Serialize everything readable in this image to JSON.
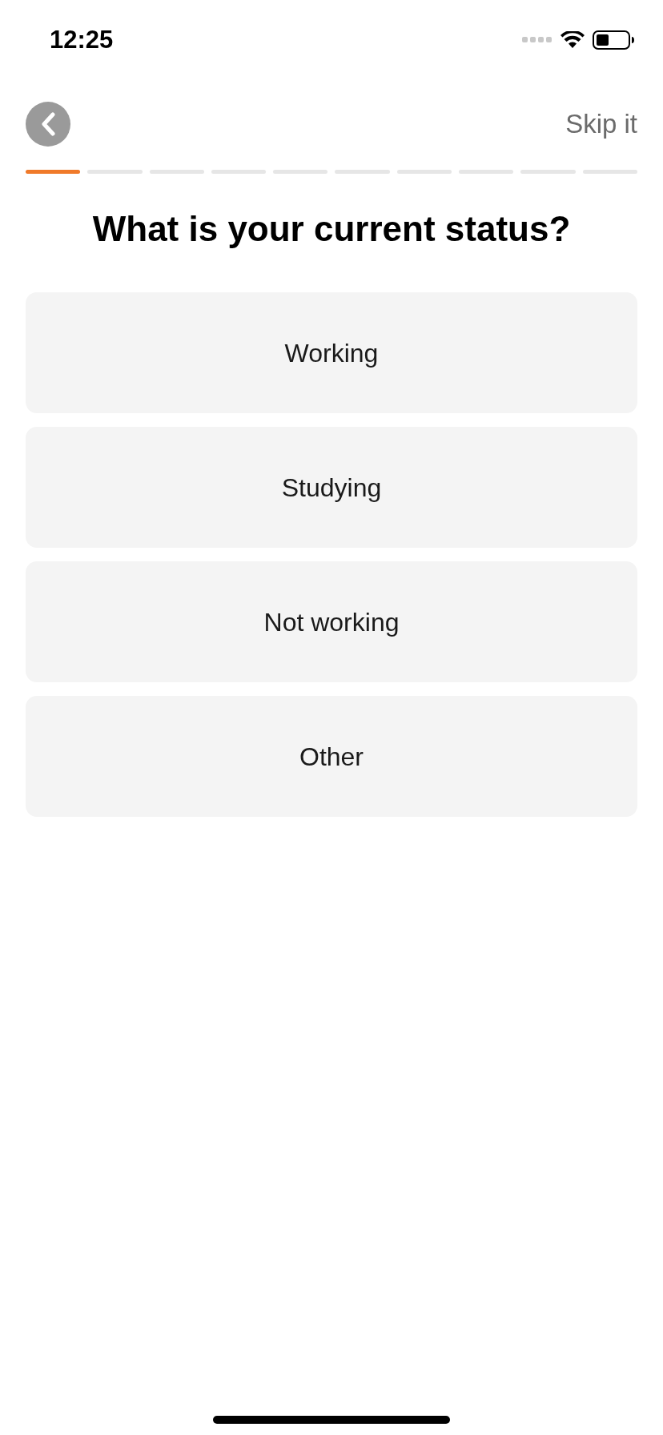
{
  "status_bar": {
    "time": "12:25"
  },
  "header": {
    "skip_label": "Skip it"
  },
  "progress": {
    "steps": [
      {
        "done": true
      },
      {
        "done": false
      },
      {
        "done": false
      },
      {
        "done": false
      },
      {
        "done": false
      },
      {
        "done": false
      },
      {
        "done": false
      },
      {
        "done": false
      },
      {
        "done": false
      },
      {
        "done": false
      }
    ]
  },
  "question": "What is your current status?",
  "options": [
    {
      "label": "Working",
      "selected": false
    },
    {
      "label": "Studying",
      "selected": false
    },
    {
      "label": "Not working",
      "selected": false
    },
    {
      "label": "Other",
      "selected": false
    }
  ]
}
